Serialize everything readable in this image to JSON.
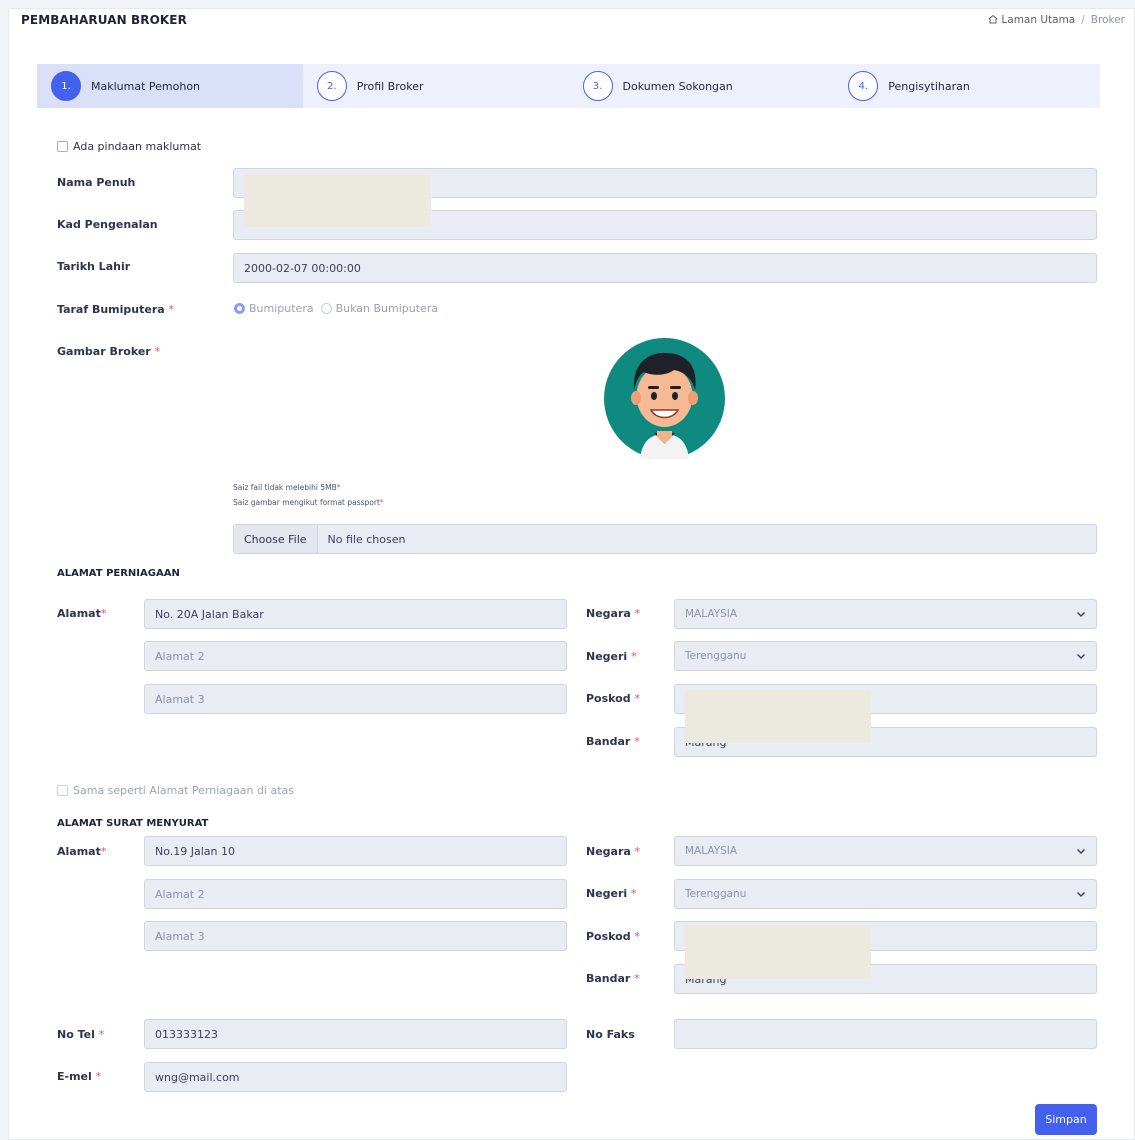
{
  "header": {
    "title": "PEMBAHARUAN BROKER",
    "breadcrumb": {
      "home": "Laman Utama",
      "separator": "/",
      "current": "Broker"
    }
  },
  "stepper": [
    {
      "num": "1.",
      "label": "Maklumat Pemohon",
      "active": true
    },
    {
      "num": "2.",
      "label": "Profil Broker",
      "active": false
    },
    {
      "num": "3.",
      "label": "Dokumen Sokongan",
      "active": false
    },
    {
      "num": "4.",
      "label": "Pengisytiharan",
      "active": false
    }
  ],
  "form": {
    "amend_checkbox": "Ada pindaan maklumat",
    "nama_penuh": {
      "label": "Nama Penuh",
      "value": ""
    },
    "kad_pengenalan": {
      "label": "Kad Pengenalan",
      "value": ""
    },
    "tarikh_lahir": {
      "label": "Tarikh Lahir",
      "value": "2000-02-07 00:00:00"
    },
    "taraf": {
      "label": "Taraf Bumiputera",
      "required": "*",
      "options": [
        "Bumiputera",
        "Bukan Bumiputera"
      ],
      "selected": "Bumiputera"
    },
    "gambar": {
      "label": "Gambar Broker",
      "required": "*",
      "note1": "Saiz fail tidak melebihi 5MB",
      "note2": "Saiz gambar mengikut format passport",
      "file_button": "Choose File",
      "file_text": "No file chosen"
    }
  },
  "alamat_perniagaan": {
    "heading": "ALAMAT PERNIAGAAN",
    "alamat_label": "Alamat",
    "alamat1": "No. 20A Jalan Bakar",
    "alamat2_placeholder": "Alamat 2",
    "alamat3_placeholder": "Alamat 3",
    "negara_label": "Negara",
    "negara": "MALAYSIA",
    "negeri_label": "Negeri",
    "negeri": "Terengganu",
    "poskod_label": "Poskod",
    "bandar_label": "Bandar",
    "bandar": "Marang"
  },
  "same_checkbox": "Sama seperti Alamat Perniagaan di atas",
  "alamat_surat": {
    "heading": "ALAMAT SURAT MENYURAT",
    "alamat_label": "Alamat",
    "alamat1": "No.19 Jalan 10",
    "alamat2_placeholder": "Alamat 2",
    "alamat3_placeholder": "Alamat 3",
    "negara_label": "Negara",
    "negara": "MALAYSIA",
    "negeri_label": "Negeri",
    "negeri": "Terengganu",
    "poskod_label": "Poskod",
    "bandar_label": "Bandar",
    "bandar": "Marang"
  },
  "contact": {
    "tel_label": "No Tel",
    "tel": "013333123",
    "faks_label": "No Faks",
    "faks": "",
    "email_label": "E-mel",
    "email": "wng@mail.com"
  },
  "save_label": "Simpan",
  "required_mark": "*",
  "colors": {
    "primary": "#4361ee",
    "required": "#e7515a",
    "step_bg": "#eef1fb",
    "step_active_bg": "#d9e0f8"
  }
}
